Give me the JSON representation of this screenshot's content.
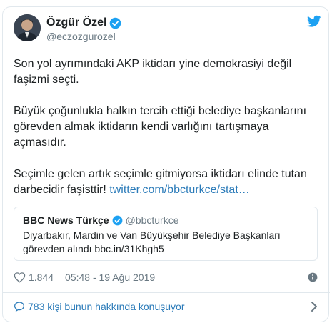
{
  "author": {
    "display_name": "Özgür Özel",
    "handle": "@eczozgurozel"
  },
  "tweet": {
    "line1": "Son yol ayrımındaki AKP iktidarı yine demokrasiyi değil faşizmi seçti.",
    "line2": "Büyük çoğunlukla halkın tercih ettiği belediye başkanlarını görevden almak iktidarın kendi varlığını tartışmaya açmasıdır.",
    "line3_text": "Seçimle gelen artık seçimle gitmiyorsa iktidarı elinde tutan darbecidir faşisttir! ",
    "line3_link": "twitter.com/bbcturkce/stat…"
  },
  "quote": {
    "name": "BBC News Türkçe",
    "handle": "@bbcturkce",
    "text": "Diyarbakır, Mardin ve Van Büyükşehir Belediye Başkanları görevden alındı bbc.in/31Khgh5"
  },
  "meta": {
    "likes": "1.844",
    "timestamp": "05:48 - 19 Ağu 2019"
  },
  "footer": {
    "conversation": "783 kişi bunun hakkında konuşuyor"
  },
  "colors": {
    "link": "#2b7bb9",
    "verified": "#1da1f2",
    "muted": "#697882",
    "border": "#e1e8ed"
  },
  "icons": [
    "verified-badge-icon",
    "twitter-bird-icon",
    "heart-icon",
    "info-icon",
    "speech-bubble-icon",
    "chevron-right-icon"
  ]
}
